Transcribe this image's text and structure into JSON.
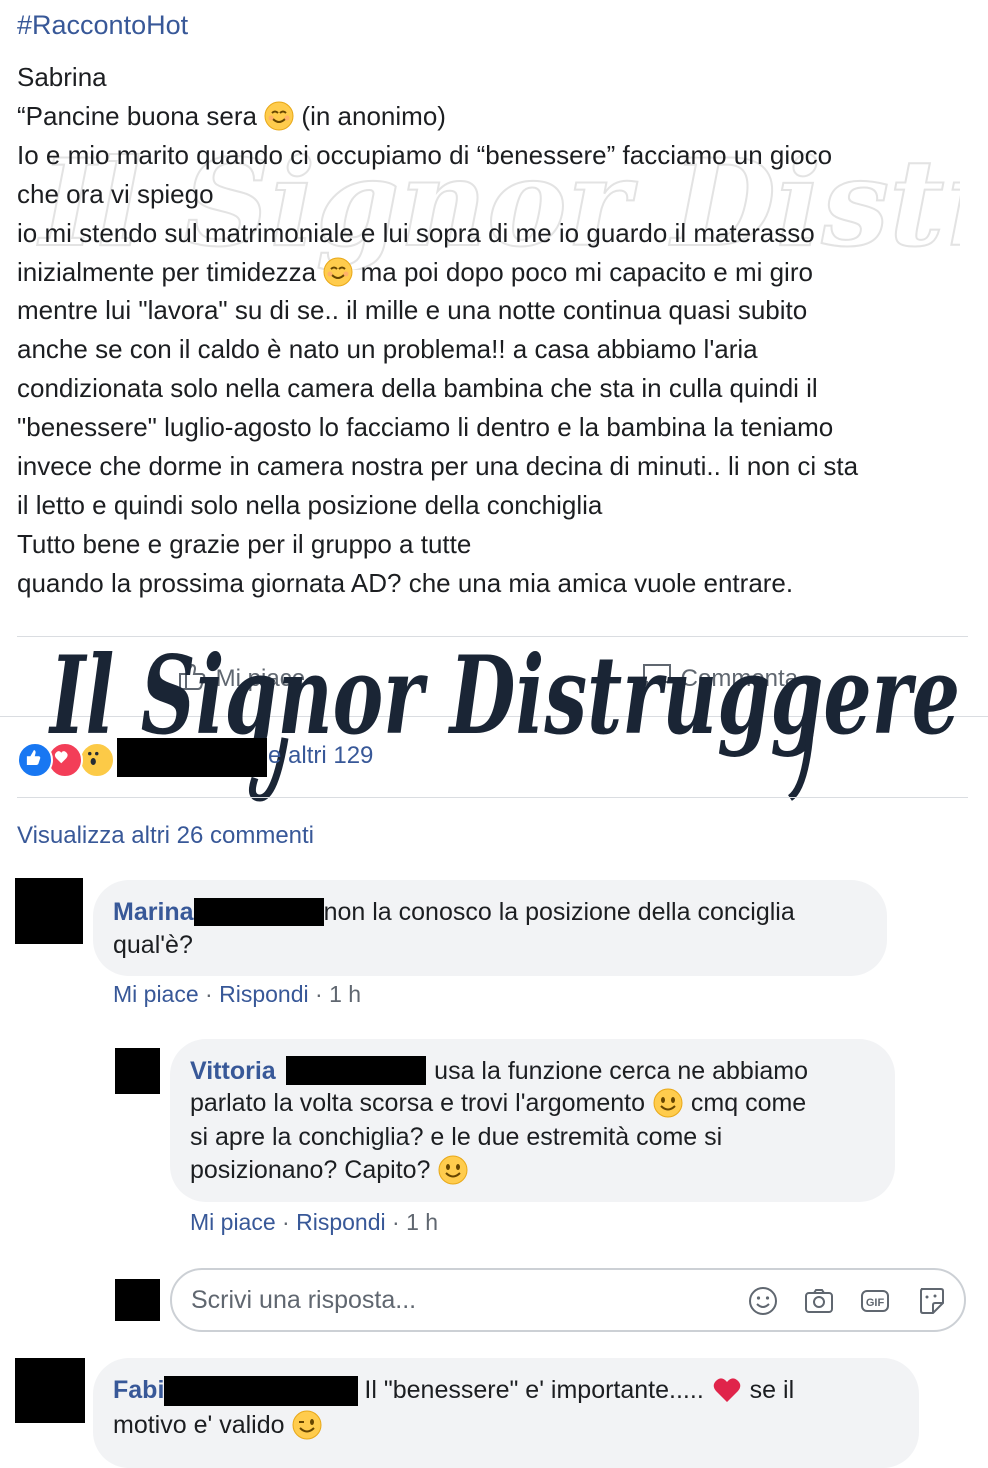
{
  "post": {
    "hashtag": "#RaccontoHot",
    "lines": [
      "Sabrina",
      "“Pancine buona sera",
      "(in anonimo)",
      "Io e mio marito quando ci occupiamo di “benessere” facciamo un gioco",
      "che ora vi spiego",
      "io mi stendo sul matrimoniale e lui sopra di me io guardo il materasso",
      "inizialmente per timidezza",
      "ma poi dopo poco mi capacito e mi giro",
      "mentre lui \"lavora\" su di se.. il mille e una notte continua quasi subito",
      "anche se con il caldo è nato un problema!! a casa abbiamo l'aria",
      "condizionata solo nella camera della bambina che sta in culla quindi il",
      "\"benessere\" luglio-agosto lo facciamo li dentro e la bambina la teniamo",
      "invece che dorme in camera nostra per una decina di minuti.. li non ci sta",
      "il letto e quindi solo nella posizione della conchiglia",
      "Tutto bene e grazie per il gruppo a tutte",
      "quando la prossima giornata AD? che una mia amica vuole entrare."
    ]
  },
  "watermark": {
    "text": "Il Signor Distruggere"
  },
  "actions": {
    "like": "Mi piace",
    "comment": "Commenta"
  },
  "reactions": {
    "icons": [
      "like-icon",
      "love-icon",
      "wow-icon"
    ],
    "count_text": "e altri 129"
  },
  "comments_link": "Visualizza altri 26 commenti",
  "comments": [
    {
      "author": "Marina",
      "line1": "non la conosco la posizione della conciglia",
      "line2": "qual'è?",
      "like": "Mi piace",
      "reply": "Rispondi",
      "time": "1 h"
    },
    {
      "author": "Vittoria",
      "line1_suffix": "i usa la funzione cerca ne abbiamo",
      "line2a": "parlato la volta scorsa e trovi l'argomento",
      "line2b": "cmq come",
      "line3": "si apre la conchiglia? e le due estremità come si",
      "line4": "posizionano? Capito?",
      "like": "Mi piace",
      "reply": "Rispondi",
      "time": "1 h"
    },
    {
      "author": "Fabi",
      "line1a": "Il \"benessere\" e' importante.....",
      "line1b": "se il",
      "line2": "motivo e' valido"
    }
  ],
  "reply_box": {
    "placeholder": "Scrivi una risposta...",
    "icons": [
      "smiley-icon",
      "camera-icon",
      "gif-icon",
      "sticker-icon"
    ]
  },
  "colors": {
    "link": "#385898",
    "text": "#1c1e21",
    "bubble": "#f2f3f5",
    "meta": "#606770"
  }
}
